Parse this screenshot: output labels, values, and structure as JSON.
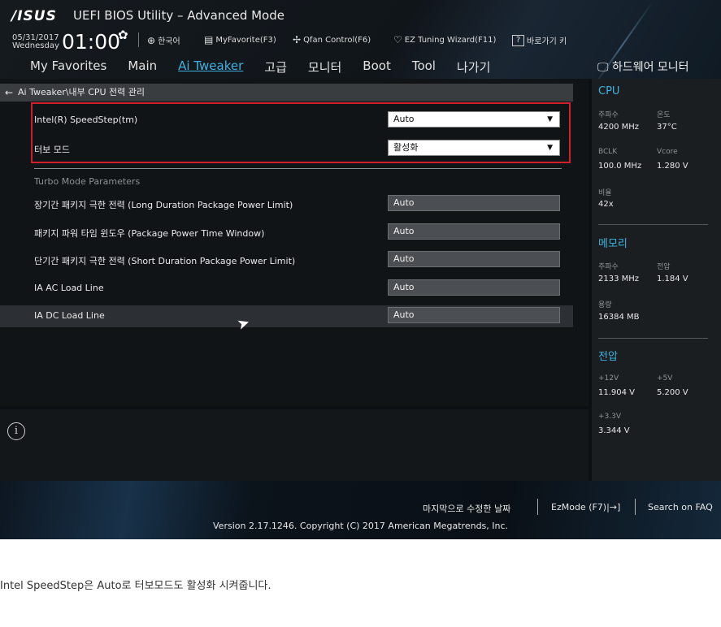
{
  "header": {
    "logo": "/ISUS",
    "title": "UEFI BIOS Utility – Advanced Mode",
    "date": "05/31/2017",
    "day": "Wednesday",
    "time": "01:00",
    "toolbar": {
      "language": "한국어",
      "my_favorite": "MyFavorite(F3)",
      "qfan": "Qfan Control(F6)",
      "ez_tuning": "EZ Tuning Wizard(F11)",
      "hotkeys": "바로가기 키"
    }
  },
  "tabs": [
    "My Favorites",
    "Main",
    "Ai Tweaker",
    "고급",
    "모니터",
    "Boot",
    "Tool",
    "나가기"
  ],
  "active_tab": "Ai Tweaker",
  "breadcrumb": "Ai Tweaker\\내부 CPU 전력 관리",
  "settings": {
    "speedstep": {
      "label": "Intel(R) SpeedStep(tm)",
      "value": "Auto"
    },
    "turbo": {
      "label": "터보 모드",
      "value": "활성화"
    },
    "section_title": "Turbo Mode Parameters",
    "long_power": {
      "label": "장기간 패키지 극한 전력 (Long Duration Package Power Limit)",
      "value": "Auto"
    },
    "time_window": {
      "label": "패키지 파워 타임 윈도우 (Package Power Time Window)",
      "value": "Auto"
    },
    "short_power": {
      "label": "단기간 패키지 극한 전력 (Short Duration Package Power Limit)",
      "value": "Auto"
    },
    "ia_ac": {
      "label": "IA AC Load Line",
      "value": "Auto"
    },
    "ia_dc": {
      "label": "IA DC Load Line",
      "value": "Auto"
    }
  },
  "hw_monitor": {
    "title": "하드웨어 모니터",
    "cpu": {
      "title": "CPU",
      "freq_label": "주파수",
      "freq": "4200 MHz",
      "temp_label": "온도",
      "temp": "37°C",
      "bclk_label": "BCLK",
      "bclk": "100.0 MHz",
      "vcore_label": "Vcore",
      "vcore": "1.280 V",
      "ratio_label": "비율",
      "ratio": "42x"
    },
    "memory": {
      "title": "메모리",
      "freq_label": "주파수",
      "freq": "2133 MHz",
      "volt_label": "전압",
      "volt": "1.184 V",
      "cap_label": "용량",
      "cap": "16384 MB"
    },
    "voltage": {
      "title": "전압",
      "v12_label": "+12V",
      "v12": "11.904 V",
      "v5_label": "+5V",
      "v5": "5.200 V",
      "v33_label": "+3.3V",
      "v33": "3.344 V"
    }
  },
  "footer": {
    "last_modified": "마지막으로 수정한 날짜",
    "ezmode": "EzMode (F7)|→]",
    "faq": "Search on FAQ",
    "version": "Version 2.17.1246. Copyright (C) 2017 American Megatrends, Inc."
  },
  "caption": "Intel SpeedStep은 Auto로 터보모드도 활성화 시켜줍니다."
}
